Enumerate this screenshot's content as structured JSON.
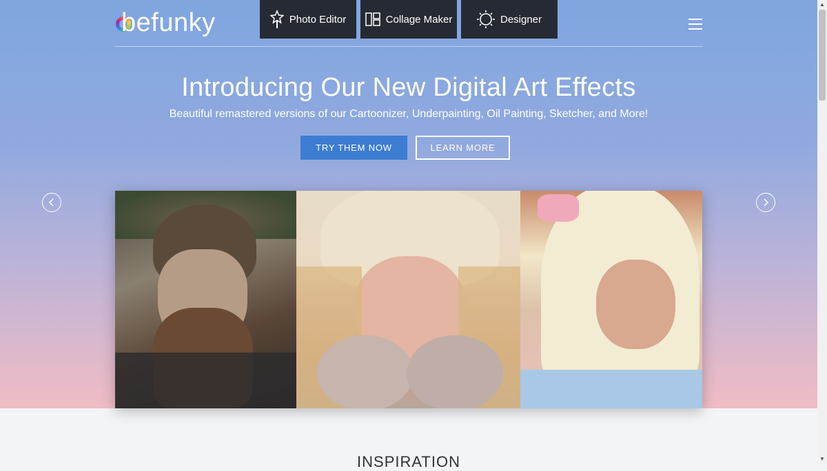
{
  "header": {
    "logo_text": "befunky",
    "nav": [
      {
        "label": "Photo Editor",
        "icon": "magic-wand-icon"
      },
      {
        "label": "Collage Maker",
        "icon": "collage-grid-icon"
      },
      {
        "label": "Designer",
        "icon": "design-sun-icon"
      }
    ],
    "menu_icon": "hamburger-menu-icon"
  },
  "hero": {
    "headline": "Introducing Our New Digital Art Effects",
    "subline": "Beautiful remastered versions of our Cartoonizer, Underpainting, Oil Painting, Sketcher, and More!",
    "primary_cta": "TRY THEM NOW",
    "secondary_cta": "LEARN MORE",
    "prev_icon": "chevron-left-circle-icon",
    "next_icon": "chevron-right-circle-icon"
  },
  "section": {
    "title": "INSPIRATION"
  },
  "colors": {
    "nav_bg": "#262b33",
    "accent": "#3d7dd1",
    "hero_top": "#7fa6df",
    "hero_bottom": "#f1bcc4"
  }
}
